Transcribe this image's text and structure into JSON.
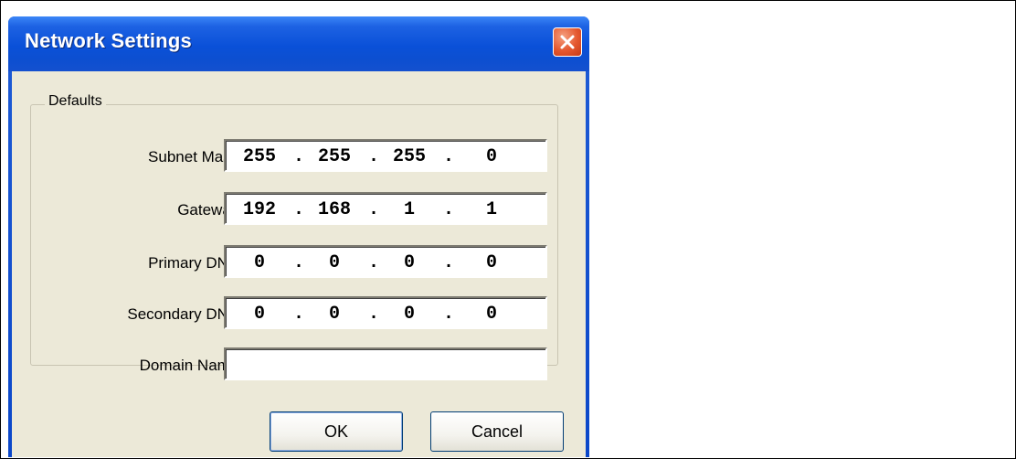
{
  "window": {
    "title": "Network Settings"
  },
  "group": {
    "label": "Defaults"
  },
  "fields": [
    {
      "label": "Subnet Mask:",
      "octets": [
        "255",
        "255",
        "255",
        "0"
      ]
    },
    {
      "label": "Gateway:",
      "octets": [
        "192",
        "168",
        "1",
        "1"
      ]
    },
    {
      "label": "Primary DNS:",
      "octets": [
        "0",
        "0",
        "0",
        "0"
      ]
    },
    {
      "label": "Secondary DNS:",
      "octets": [
        "0",
        "0",
        "0",
        "0"
      ]
    }
  ],
  "domain": {
    "label": "Domain Name:",
    "value": ""
  },
  "buttons": {
    "ok": "OK",
    "cancel": "Cancel"
  },
  "icons": {
    "close": "close-icon"
  },
  "colors": {
    "titlebar": "#0a50d8",
    "client": "#ece9d8",
    "close_button": "#e4572e"
  }
}
